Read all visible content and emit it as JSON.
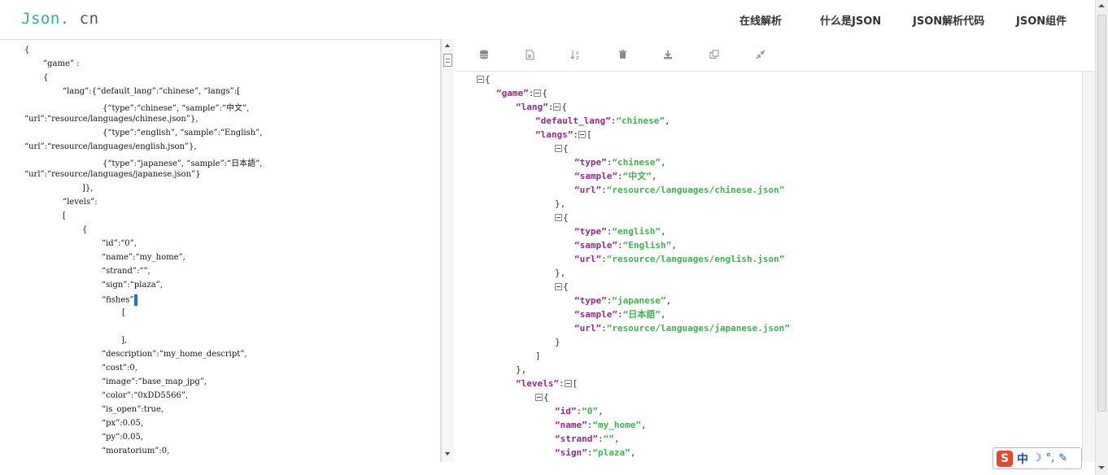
{
  "header": {
    "logo_main": "Json.",
    "logo_tld": "cn",
    "nav": [
      "在线解析",
      "什么是JSON",
      "JSON解析代码",
      "JSON组件"
    ]
  },
  "editor": {
    "lines": [
      "{",
      "“game” :",
      "{",
      "“lang”:{“default_lang”:“chinese”, “langs”:[",
      "{“type”:“chinese”, “sample”:“中文”,",
      "“url”:“resource/languages/chinese.json”},",
      "{“type”:“english”, “sample”:“English”,",
      "“url”:“resource/languages/english.json”},",
      "{“type”:“japanese”, “sample”:“日本語”,",
      "“url”:“resource/languages/japanese.json”}",
      "]},",
      "“levels”:",
      "[",
      "{",
      "“id”:“0”,",
      "“name”:“my_home”,",
      "“strand”:“”,",
      "“sign”:“plaza”,",
      "“fishes”",
      "[",
      "",
      "],",
      "“description”:“my_home_descript”,",
      "“cost”:0,",
      "“image”:“base_map_jpg”,",
      "“color”:“0xDD5566”,",
      "“is_open”:true,",
      "“px”:0.05,",
      "“py”:0.05,",
      "“moratorium”:0,"
    ]
  },
  "viewer": {
    "lines": [
      {
        "toggle": true,
        "key": "",
        "after": "{"
      },
      {
        "key": "game",
        "toggle": true,
        "after": "{"
      },
      {
        "key": "lang",
        "toggle": true,
        "after": "{"
      },
      {
        "key": "default_lang",
        "val": "chinese",
        "after": ","
      },
      {
        "key": "langs",
        "toggle": true,
        "after": "["
      },
      {
        "toggle": true,
        "key": "",
        "after": "{"
      },
      {
        "key": "type",
        "val": "chinese",
        "after": ","
      },
      {
        "key": "sample",
        "val": "中文",
        "after": ","
      },
      {
        "key": "url",
        "val": "resource/languages/chinese.json",
        "after": ""
      },
      {
        "key": "",
        "after": "},"
      },
      {
        "toggle": true,
        "key": "",
        "after": "{"
      },
      {
        "key": "type",
        "val": "english",
        "after": ","
      },
      {
        "key": "sample",
        "val": "English",
        "after": ","
      },
      {
        "key": "url",
        "val": "resource/languages/english.json",
        "after": ""
      },
      {
        "key": "",
        "after": "},"
      },
      {
        "toggle": true,
        "key": "",
        "after": "{"
      },
      {
        "key": "type",
        "val": "japanese",
        "after": ","
      },
      {
        "key": "sample",
        "val": "日本語",
        "after": ","
      },
      {
        "key": "url",
        "val": "resource/languages/japanese.json",
        "after": ""
      },
      {
        "key": "",
        "after": "}"
      },
      {
        "key": "",
        "after": "]"
      },
      {
        "key": "",
        "after": "},"
      },
      {
        "key": "levels",
        "toggle": true,
        "after": "["
      },
      {
        "toggle": true,
        "key": "",
        "after": "{"
      },
      {
        "key": "id",
        "val": "0",
        "after": ","
      },
      {
        "key": "name",
        "val": "my_home",
        "after": ","
      },
      {
        "key": "strand",
        "val": "",
        "after": ","
      },
      {
        "key": "sign",
        "val": "plaza",
        "after": ","
      }
    ]
  },
  "toolbar": {
    "icons": [
      "database-icon",
      "excel-icon",
      "sort-icon",
      "trash-icon",
      "download-icon",
      "copy-icon",
      "compress-icon"
    ]
  },
  "ime": {
    "logo": "S",
    "mode": "中",
    "moon": "☽",
    "dot": "°,",
    "tool": "✎"
  }
}
